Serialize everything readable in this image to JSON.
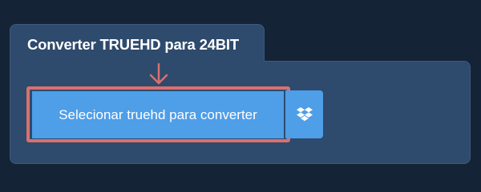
{
  "converter": {
    "title": "Converter TRUEHD para 24BIT",
    "select_button_label": "Selecionar truehd para converter"
  },
  "icons": {
    "arrow": "arrow-down-icon",
    "dropbox": "dropbox-icon"
  },
  "colors": {
    "page_background": "#142335",
    "panel_background": "#2e4a6c",
    "button_blue": "#4e9ee8",
    "highlight_red": "#d9706f"
  }
}
